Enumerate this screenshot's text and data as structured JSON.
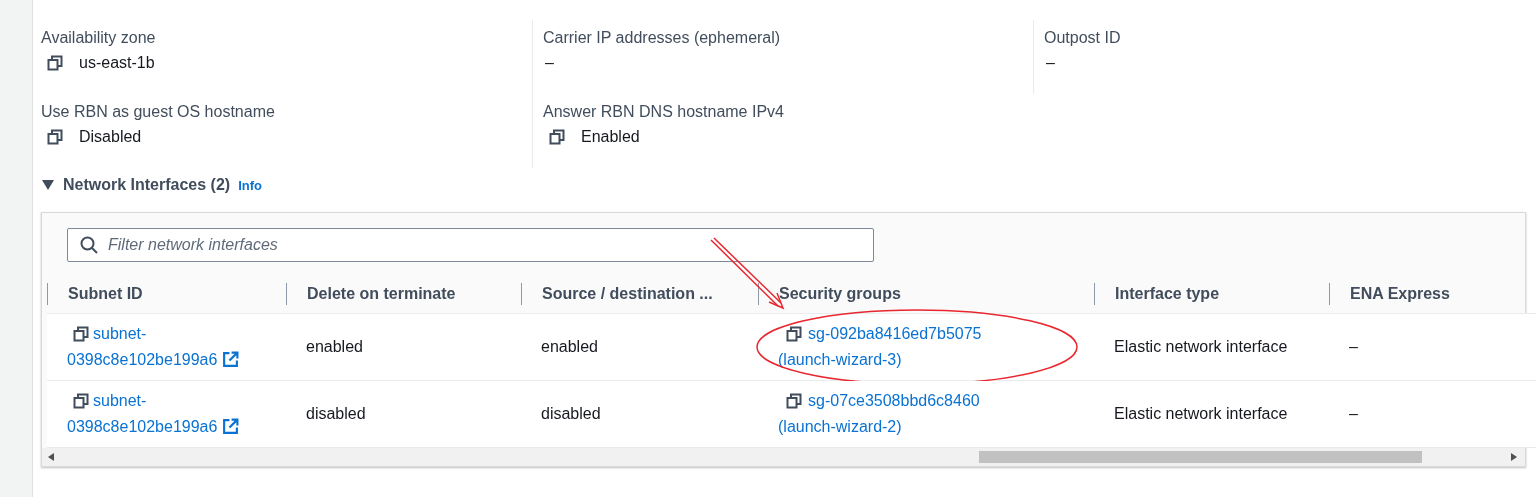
{
  "details": [
    {
      "label": "Availability zone",
      "value": "us-east-1b",
      "copyable": true
    },
    {
      "label": "Carrier IP addresses (ephemeral)",
      "value": "–",
      "copyable": false
    },
    {
      "label": "Outpost ID",
      "value": "–",
      "copyable": false
    },
    {
      "label": "Use RBN as guest OS hostname",
      "value": "Disabled",
      "copyable": true
    },
    {
      "label": "Answer RBN DNS hostname IPv4",
      "value": "Enabled",
      "copyable": true
    }
  ],
  "section": {
    "title": "Network Interfaces (2)",
    "expanded": true,
    "info": "Info"
  },
  "filter": {
    "placeholder": "Filter network interfaces"
  },
  "table": {
    "columns": [
      "Subnet ID",
      "Delete on terminate",
      "Source / destination ...",
      "Security groups",
      "Interface type",
      "ENA Express"
    ],
    "rows": [
      {
        "subnet": "subnet-0398c8e102be199a6",
        "delete_on_terminate": "enabled",
        "source_dest": "enabled",
        "security_group": "sg-092ba8416ed7b5075 (launch-wizard-3)",
        "interface_type": "Elastic network interface",
        "ena_express": "–",
        "annotated": true
      },
      {
        "subnet": "subnet-0398c8e102be199a6",
        "delete_on_terminate": "disabled",
        "source_dest": "disabled",
        "security_group": "sg-07ce3508bbd6c8460 (launch-wizard-2)",
        "interface_type": "Elastic network interface",
        "ena_express": "–",
        "annotated": false
      }
    ]
  }
}
